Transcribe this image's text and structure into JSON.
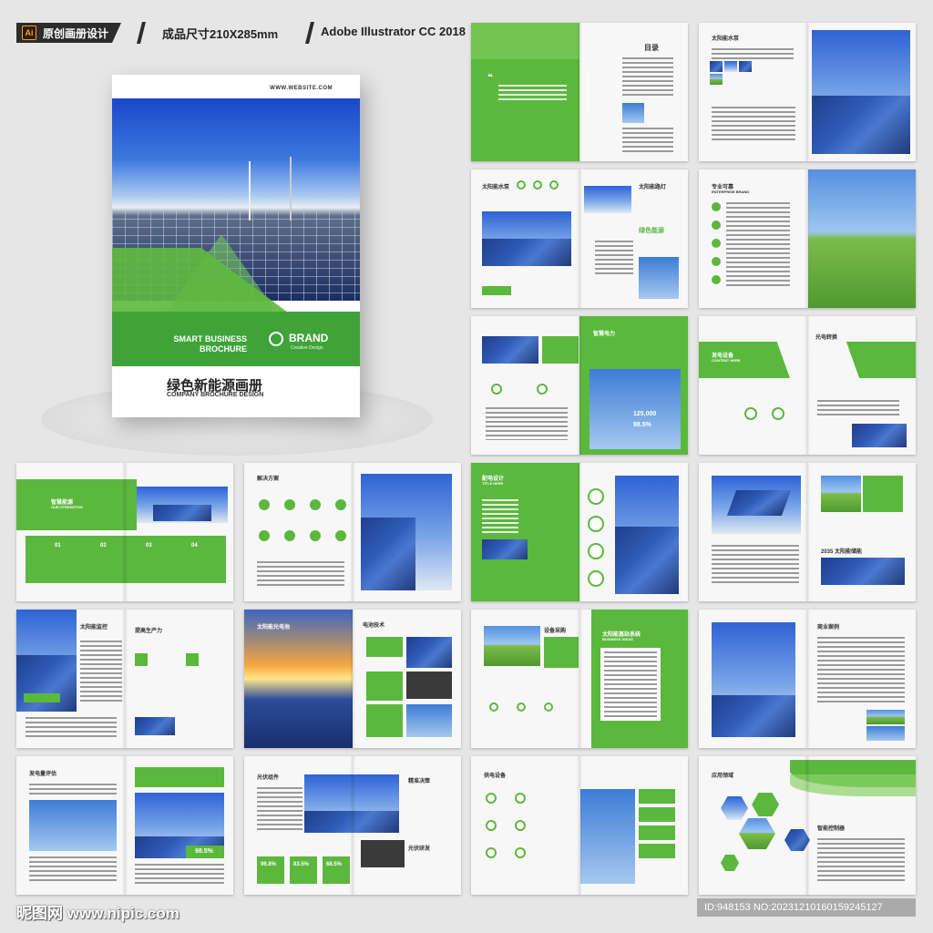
{
  "header": {
    "app_badge": "Ai",
    "label_original": "原创画册设计",
    "label_size": "成品尺寸210X285mm",
    "label_software": "Adobe Illustrator CC 2018"
  },
  "cover": {
    "website": "WWW.WEBSITE.COM",
    "smart_business": "SMART BUSINESS",
    "brochure": "BROCHURE",
    "brand": "BRAND",
    "brand_sub": "Creative Design",
    "title_cn": "绿色新能源画册",
    "subtitle": "COMPANY BROCHURE DESIGN"
  },
  "spreads": {
    "toc_title": "目录",
    "toc_en": "TABLE OF CONTENTS",
    "solar_pump": "太阳能水泵",
    "product_intro": "PRODUCT INTRODUCTION",
    "solar_streetlight": "太阳能路灯",
    "pro_reliable": "专业可靠",
    "enterprise_brand": "ENTERPRISE BRAND",
    "smart_power": "智慧电力",
    "pv_conversion": "光电转换",
    "power_equipment": "发电设备",
    "content_here": "CONTENT HERE",
    "stat_a": "125,000",
    "stat_b": "98.5%",
    "smart_energy": "智慧能源",
    "our_strengths": "OUR STRENGTHS",
    "num_01": "01",
    "num_02": "02",
    "num_03": "03",
    "num_04": "04",
    "solutions": "解决方案",
    "distribution_design": "配电设计",
    "title_here": "TITLE HERE",
    "solar_2035": "2035 太阳能储能",
    "solar_monitoring": "太阳能监控",
    "improve_productivity": "提高生产力",
    "solar_cells": "太阳能光电池",
    "power_tech": "电池技术",
    "equipment_purchase": "设备采购",
    "solar_base_system": "太阳能基站系统",
    "business_ideas": "BUSINESS IDEAS",
    "business_cases": "商业案例",
    "generation_eval": "发电量评估",
    "stat_c": "98.5%",
    "pv_module": "光伏组件",
    "precise_decision": "精准决策",
    "pv_rd": "光伏研发",
    "pct_1": "96.8%",
    "pct_2": "83.5%",
    "pct_3": "68.5%",
    "power_supply": "供电设备",
    "application": "应用领域",
    "smart_controller": "智能控制器"
  },
  "footer": {
    "watermark": "昵图网 www.nipic.com",
    "image_id": "ID:948153 NO:20231210160159245127"
  }
}
